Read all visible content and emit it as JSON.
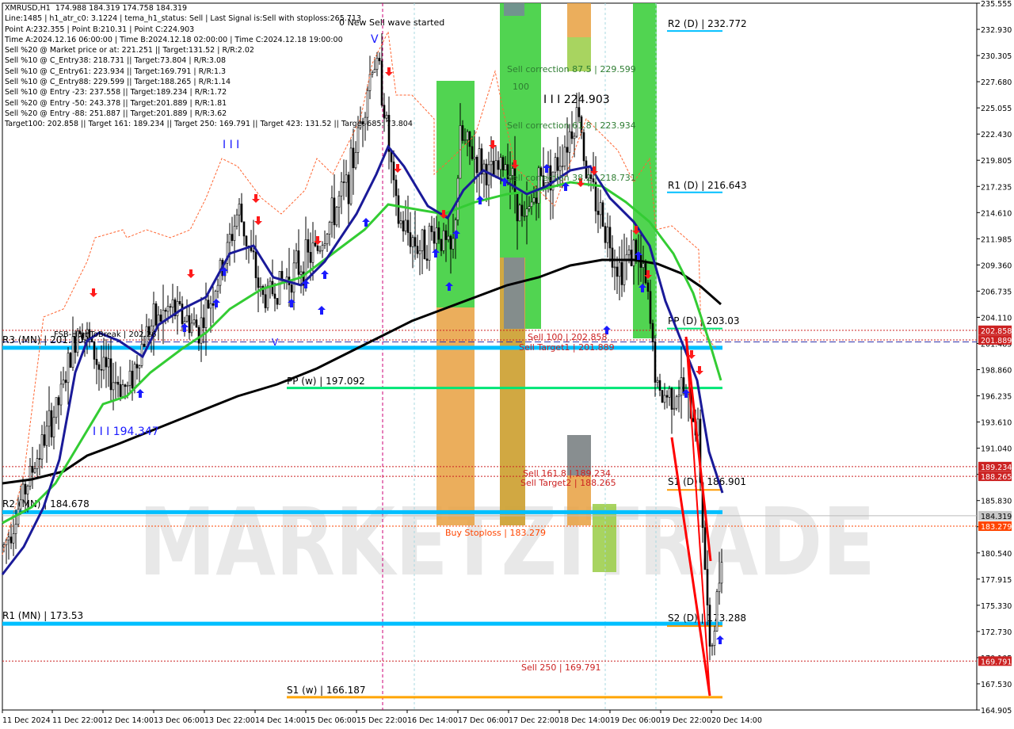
{
  "info_lines": [
    "XMRUSD,H1  174.988 184.319 174.758 184.319",
    "Line:1485 | h1_atr_c0: 3.1224 | tema_h1_status: Sell | Last Signal is:Sell with stoploss:265.713",
    "Point A:232.355 | Point B:210.31 | Point C:224.903",
    "Time A:2024.12.16 06:00:00 | Time B:2024.12.18 02:00:00 | Time C:2024.12.18 19:00:00",
    "Sell %20 @ Market price or at: 221.251 || Target:131.52 | R/R:2.02",
    "Sell %10 @ C_Entry38: 218.731 || Target:73.804 | R/R:3.08",
    "Sell %10 @ C_Entry61: 223.934 || Target:169.791 | R/R:1.3",
    "Sell %10 @ C_Entry88: 229.599 || Target:188.265 | R/R:1.14",
    "Sell %10 @ Entry -23: 237.558 || Target:189.234 | R/R:1.72",
    "Sell %20 @ Entry -50: 243.378 || Target:201.889 | R/R:1.81",
    "Sell %20 @ Entry -88: 251.887 || Target:201.889 | R/R:3.62",
    "Target100: 202.858 || Target 161: 189.234 || Target 250: 169.791 || Target 423: 131.52 || Target 685: 73.804"
  ],
  "chart_data": {
    "type": "candlestick",
    "symbol": "XMRUSD",
    "timeframe": "H1",
    "ohlc_last": {
      "open": 174.988,
      "high": 184.319,
      "low": 174.758,
      "close": 184.319
    },
    "ylim": [
      164.905,
      235.555
    ],
    "y_ticks": [
      "235.555",
      "232.930",
      "230.305",
      "227.680",
      "225.055",
      "222.430",
      "219.805",
      "217.235",
      "214.610",
      "211.985",
      "209.360",
      "206.735",
      "204.110",
      "201.485",
      "198.860",
      "196.235",
      "193.610",
      "191.040",
      "188.415",
      "185.830",
      "183.165",
      "180.540",
      "177.915",
      "175.330",
      "172.730",
      "170.105",
      "167.530",
      "164.905"
    ],
    "x_ticks": [
      "11 Dec 2024",
      "11 Dec 22:00",
      "12 Dec 14:00",
      "13 Dec 06:00",
      "13 Dec 22:00",
      "14 Dec 14:00",
      "15 Dec 06:00",
      "15 Dec 22:00",
      "16 Dec 14:00",
      "17 Dec 06:00",
      "17 Dec 22:00",
      "18 Dec 14:00",
      "19 Dec 06:00",
      "19 Dec 22:00",
      "20 Dec 14:00"
    ],
    "price_badges": [
      {
        "value": 202.858,
        "label": "202.858",
        "color": "#cc2222"
      },
      {
        "value": 201.889,
        "label": "201.889",
        "color": "#cc2222"
      },
      {
        "value": 189.234,
        "label": "189.234",
        "color": "#cc2222"
      },
      {
        "value": 188.265,
        "label": "188.265",
        "color": "#cc2222"
      },
      {
        "value": 184.319,
        "label": "184.319",
        "color": "#c8c8c8"
      },
      {
        "value": 183.279,
        "label": "183.279",
        "color": "#ff4500"
      },
      {
        "value": 169.791,
        "label": "169.791",
        "color": "#cc2222"
      }
    ],
    "levels": [
      {
        "label": "R2 (D) | 232.772",
        "value": 232.772,
        "color": "#00bfff"
      },
      {
        "label": "R1 (D) | 216.643",
        "value": 216.643,
        "color": "#00bfff"
      },
      {
        "label": "PP (D) | 203.03",
        "value": 203.03,
        "color": "#00e676"
      },
      {
        "label": "R3 (MN) | 201.109",
        "value": 201.109,
        "color": "#00bfff"
      },
      {
        "label": "PP (w) | 197.092",
        "value": 197.092,
        "color": "#00e676"
      },
      {
        "label": "S1 (D) | 186.901",
        "value": 186.901,
        "color": "#ff9900"
      },
      {
        "label": "R2 (MN) | 184.678",
        "value": 184.678,
        "color": "#00bfff"
      },
      {
        "label": "S2 (D) | 173.288",
        "value": 173.288,
        "color": "#ff9900"
      },
      {
        "label": "R1 (MN) | 173.53",
        "value": 173.53,
        "color": "#00bfff"
      },
      {
        "label": "S1 (w) | 166.187",
        "value": 166.187,
        "color": "#ffa500"
      }
    ],
    "annotations": [
      {
        "text": "0 New Sell wave started",
        "color": "#000000"
      },
      {
        "text": "Sell correction 87.5 | 229.599",
        "color": "#2e7d32"
      },
      {
        "text": "100",
        "color": "#2e7d32"
      },
      {
        "text": "I I I 224.903",
        "color": "#000000"
      },
      {
        "text": "Sell correction 61.8 | 223.934",
        "color": "#2e7d32"
      },
      {
        "text": "Sell correction 38.2 | 218.731",
        "color": "#2e7d32"
      },
      {
        "text": "Sell 100 | 202.858",
        "color": "#cc2222"
      },
      {
        "text": "Sell Target1 | 201.889",
        "color": "#cc2222"
      },
      {
        "text": "Sell 161.8 | 189.234",
        "color": "#cc2222"
      },
      {
        "text": "Sell Target2 | 188.265",
        "color": "#cc2222"
      },
      {
        "text": "Buy Stoploss | 183.279",
        "color": "#ff4500"
      },
      {
        "text": "Sell  250 | 169.791",
        "color": "#cc2222"
      },
      {
        "text": "I I I 194.347",
        "color": "#1a1aff"
      },
      {
        "text": "I I I",
        "color": "#1a1aff"
      },
      {
        "text": "FSB-HighToBreak | 202.26",
        "color": "#000000"
      },
      {
        "text": "V",
        "color": "#1a1aff"
      }
    ],
    "watermark": "MARKETZITRADE"
  }
}
